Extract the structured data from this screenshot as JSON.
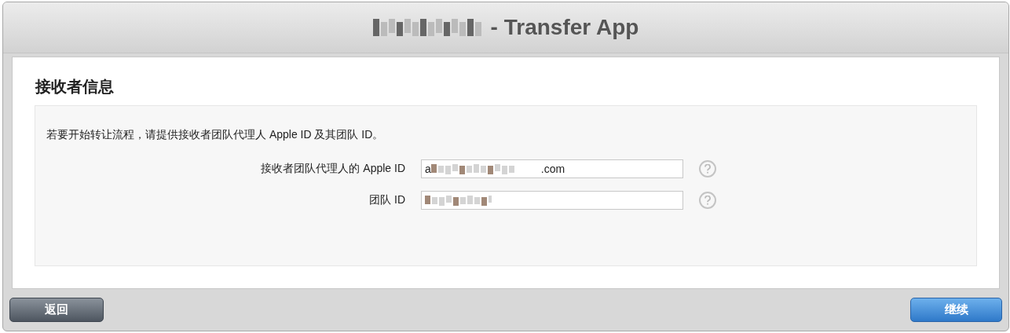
{
  "window": {
    "title": "- Transfer App"
  },
  "section": {
    "title": "接收者信息",
    "description": "若要开始转让流程，请提供接收者团队代理人 Apple ID 及其团队 ID。",
    "fields": [
      {
        "label": "接收者团队代理人的 Apple ID",
        "value_start": "a",
        "value_end": ".com"
      },
      {
        "label": "团队 ID"
      }
    ]
  },
  "buttons": [
    {
      "kind": "back",
      "label": "返回"
    },
    {
      "kind": "primary",
      "label": "继续"
    }
  ]
}
